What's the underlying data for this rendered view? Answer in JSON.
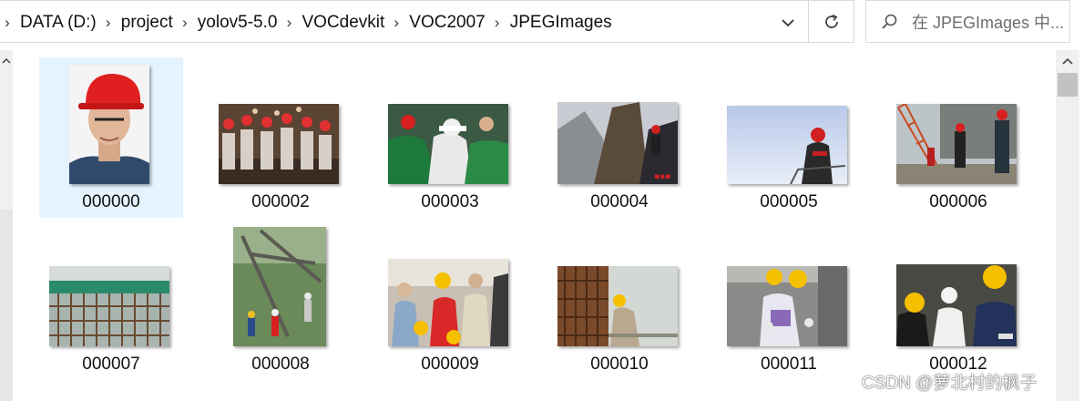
{
  "address_bar": {
    "crumbs": [
      "DATA (D:)",
      "project",
      "yolov5-5.0",
      "VOCdevkit",
      "VOC2007",
      "JPEGImages"
    ]
  },
  "search": {
    "placeholder": "在 JPEGImages 中..."
  },
  "files": [
    {
      "name": "000000",
      "selected": true
    },
    {
      "name": "000002",
      "selected": false
    },
    {
      "name": "000003",
      "selected": false
    },
    {
      "name": "000004",
      "selected": false
    },
    {
      "name": "000005",
      "selected": false
    },
    {
      "name": "000006",
      "selected": false
    },
    {
      "name": "000007",
      "selected": false
    },
    {
      "name": "000008",
      "selected": false
    },
    {
      "name": "000009",
      "selected": false
    },
    {
      "name": "000010",
      "selected": false
    },
    {
      "name": "000011",
      "selected": false
    },
    {
      "name": "000012",
      "selected": false
    }
  ],
  "watermark": "CSDN @萝北村的枫子",
  "colors": {
    "selection": "#e5f3ff",
    "helmet_red": "#e02020",
    "helmet_yellow": "#f5c000"
  }
}
